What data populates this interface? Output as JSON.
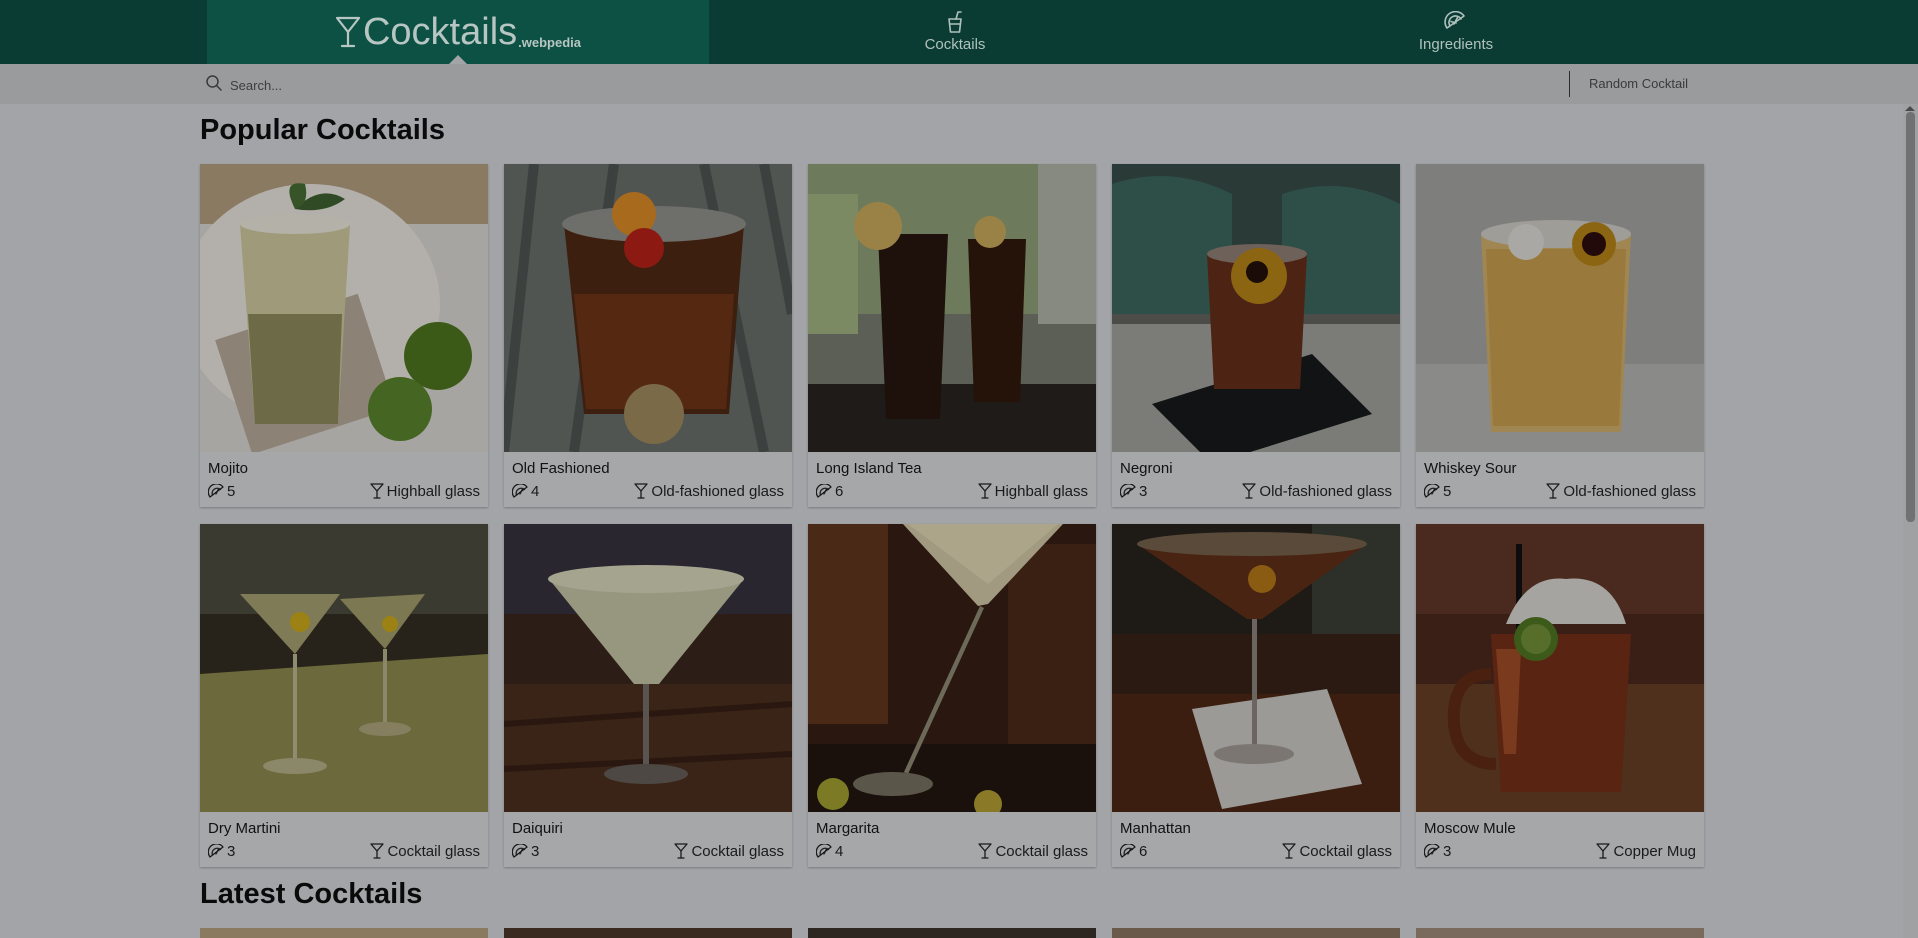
{
  "brand": {
    "name": "Cocktails",
    "suffix": ".webpedia"
  },
  "nav": {
    "cocktails": "Cocktails",
    "ingredients": "Ingredients"
  },
  "search": {
    "placeholder": "Search...",
    "random_label": "Random Cocktail"
  },
  "sections": {
    "popular_title": "Popular Cocktails",
    "latest_title": "Latest Cocktails"
  },
  "cards": [
    {
      "name": "Mojito",
      "ingredients": "5",
      "glass": "Highball glass"
    },
    {
      "name": "Old Fashioned",
      "ingredients": "4",
      "glass": "Old-fashioned glass"
    },
    {
      "name": "Long Island Tea",
      "ingredients": "6",
      "glass": "Highball glass"
    },
    {
      "name": "Negroni",
      "ingredients": "3",
      "glass": "Old-fashioned glass"
    },
    {
      "name": "Whiskey Sour",
      "ingredients": "5",
      "glass": "Old-fashioned glass"
    },
    {
      "name": "Dry Martini",
      "ingredients": "3",
      "glass": "Cocktail glass"
    },
    {
      "name": "Daiquiri",
      "ingredients": "3",
      "glass": "Cocktail glass"
    },
    {
      "name": "Margarita",
      "ingredients": "4",
      "glass": "Cocktail glass"
    },
    {
      "name": "Manhattan",
      "ingredients": "6",
      "glass": "Cocktail glass"
    },
    {
      "name": "Moscow Mule",
      "ingredients": "3",
      "glass": "Copper Mug"
    }
  ],
  "icons": {
    "brand": "cocktail-glass-icon",
    "nav_cocktails": "drink-cup-icon",
    "nav_ingredients": "lime-slice-icon",
    "search": "search-icon",
    "ingredient_count": "lime-slice-icon",
    "glass_type": "cocktail-glass-icon"
  },
  "colors": {
    "nav_background": "#0a3c33",
    "brand_background": "#0d5145",
    "overlay": "#a2a4a7"
  }
}
